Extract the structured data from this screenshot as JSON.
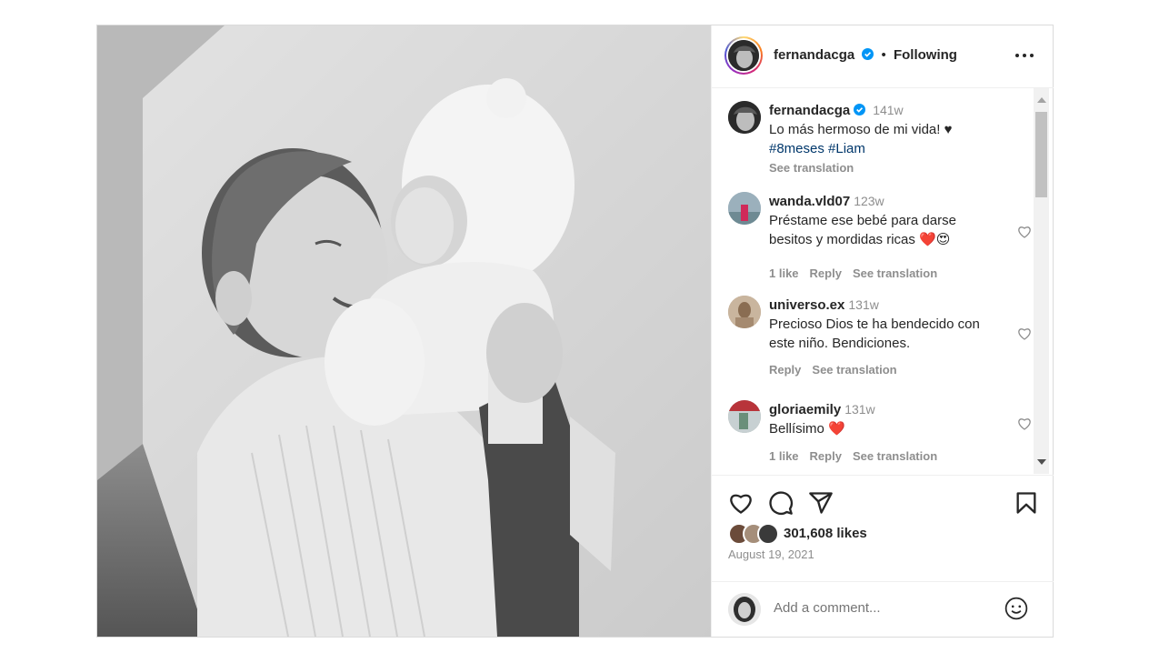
{
  "post": {
    "author": "fernandacga",
    "follow_status": "Following",
    "separator": "•",
    "caption": {
      "username": "fernandacga",
      "time": "141w",
      "text": "Lo más hermoso de mi vida! ♥",
      "hashtags": "#8meses #Liam",
      "see_translation": "See translation"
    },
    "comments": [
      {
        "username": "wanda.vld07",
        "time": "123w",
        "text": "Préstame ese bebé para darse besitos y mordidas ricas ❤️😍",
        "likes": "1 like",
        "reply": "Reply",
        "see_translation": "See translation",
        "avatar_color": "#8aa3b0"
      },
      {
        "username": "universo.ex",
        "time": "131w",
        "text": "Precioso Dios te ha bendecido con este niño. Bendiciones.",
        "likes": "",
        "reply": "Reply",
        "see_translation": "See translation",
        "avatar_color": "#b7a089"
      },
      {
        "username": "gloriaemily",
        "time": "131w",
        "text": "Bellísimo ❤️",
        "likes": "1 like",
        "reply": "Reply",
        "see_translation": "See translation",
        "avatar_color": "#9aa7a0"
      }
    ],
    "likes_count": "301,608 likes",
    "date": "August 19, 2021",
    "add_comment_placeholder": "Add a comment..."
  },
  "colors": {
    "verified": "#0095f6",
    "hashtag": "#00376b",
    "muted": "#8e8e8e",
    "border": "#dbdbdb"
  },
  "icons": [
    "more-options-icon",
    "verified-badge-icon",
    "heart-icon",
    "comment-icon",
    "share-icon",
    "bookmark-icon",
    "emoji-icon"
  ]
}
